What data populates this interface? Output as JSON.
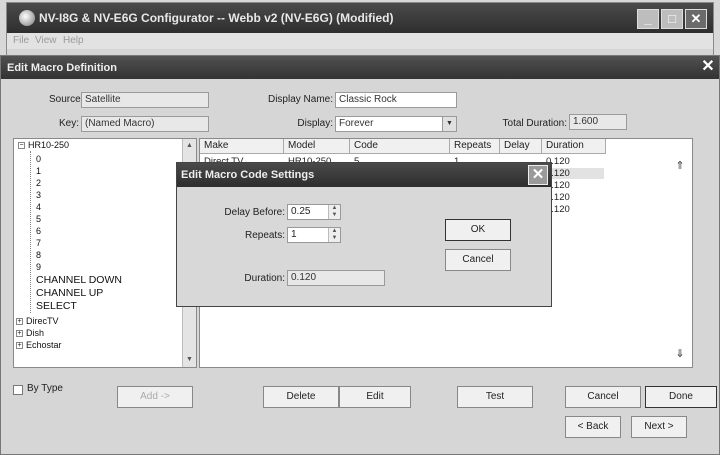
{
  "app": {
    "title": "NV-I8G & NV-E6G Configurator -- Webb v2 (NV-E6G) (Modified)",
    "menu": [
      "File",
      "View",
      "Help"
    ],
    "window_buttons": {
      "minimize": "_",
      "maximize": "□",
      "close": "✕"
    }
  },
  "macro_window": {
    "title": "Edit Macro Definition",
    "source_label": "Source:",
    "source_value": "Satellite",
    "key_label": "Key:",
    "key_value": "(Named Macro)",
    "display_name_label": "Display Name:",
    "display_name_value": "Classic Rock",
    "display_label": "Display:",
    "display_value": "Forever",
    "total_duration_label": "Total Duration:",
    "total_duration_value": "1.600",
    "close": "✕"
  },
  "tree": {
    "root": "HR10-250",
    "children": [
      "0",
      "1",
      "2",
      "3",
      "4",
      "5",
      "6",
      "7",
      "8",
      "9",
      "CHANNEL DOWN",
      "CHANNEL UP",
      "SELECT"
    ],
    "siblings": [
      "DirecTV",
      "Dish",
      "Echostar"
    ],
    "expander_minus": "−",
    "expander_plus": "+"
  },
  "grid": {
    "columns": [
      "Make",
      "Model",
      "Code",
      "Repeats",
      "Delay",
      "Duration"
    ],
    "row1": {
      "make": "Direct TV",
      "model": "HR10-250",
      "code": "5",
      "repeats": "1"
    },
    "durations": [
      "0.120",
      "0.120",
      "0.120",
      "0.120",
      "0.120",
      "0.120"
    ],
    "up_label": "⇑",
    "down_label": "⇓"
  },
  "bottom": {
    "by_type_label": "By Type",
    "add": "Add ->",
    "delete": "Delete",
    "edit": "Edit",
    "test": "Test",
    "cancel": "Cancel",
    "done": "Done",
    "back": "< Back",
    "next": "Next >"
  },
  "dialog": {
    "title": "Edit Macro Code Settings",
    "delay_before_label": "Delay Before:",
    "delay_before_value": "0.25",
    "repeats_label": "Repeats:",
    "repeats_value": "1",
    "duration_label": "Duration:",
    "duration_value": "0.120",
    "ok": "OK",
    "cancel": "Cancel",
    "close": "✕"
  }
}
